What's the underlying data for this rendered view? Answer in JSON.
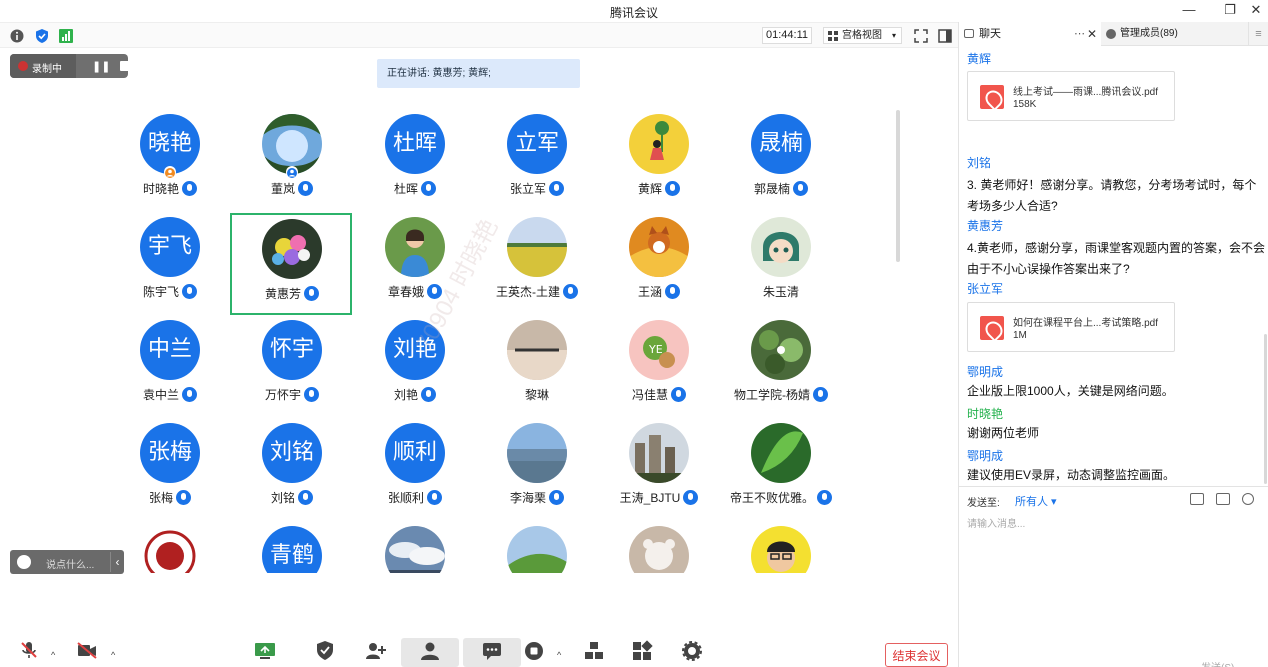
{
  "window": {
    "title": "腾讯会议",
    "min": "—",
    "max": "❐",
    "close": "✕"
  },
  "toolbar": {
    "timer": "01:44:11",
    "view_label": "宫格视图"
  },
  "recording": {
    "label": "录制中"
  },
  "speaking": {
    "text": "正在讲话: 黄惠芳; 黄辉;"
  },
  "grid": [
    {
      "name": "时晓艳",
      "avatar_text": "晓艳",
      "mic": true,
      "host_badge": true
    },
    {
      "name": "董岚",
      "avatar_img": "tree-sky",
      "mic": true,
      "user_badge": true
    },
    {
      "name": "杜晖",
      "avatar_text": "杜晖",
      "mic": true
    },
    {
      "name": "张立军",
      "avatar_text": "立军",
      "mic": true
    },
    {
      "name": "黄辉",
      "avatar_img": "girl-flower",
      "mic": true
    },
    {
      "name": "郭晟楠",
      "avatar_text": "晟楠",
      "mic": true
    },
    {
      "name": "陈宇飞",
      "avatar_text": "宇飞",
      "mic": true
    },
    {
      "name": "黄惠芳",
      "avatar_img": "flowers",
      "mic": true,
      "active": true
    },
    {
      "name": "章春娥",
      "avatar_img": "woman-blue",
      "mic": true
    },
    {
      "name": "王英杰-土建",
      "avatar_img": "field",
      "mic": true
    },
    {
      "name": "王涵",
      "avatar_img": "dog",
      "mic": true
    },
    {
      "name": "朱玉清",
      "avatar_img": "anime",
      "mic": false
    },
    {
      "name": "袁中兰",
      "avatar_text": "中兰",
      "mic": true
    },
    {
      "name": "万怀宇",
      "avatar_text": "怀宇",
      "mic": true
    },
    {
      "name": "刘艳",
      "avatar_text": "刘艳",
      "mic": true
    },
    {
      "name": "黎琳",
      "avatar_img": "sunset",
      "mic": false
    },
    {
      "name": "冯佳慧",
      "avatar_img": "cartoon",
      "mic": true
    },
    {
      "name": "物工学院-杨婧",
      "avatar_img": "leaves",
      "mic": true
    },
    {
      "name": "张梅",
      "avatar_text": "张梅",
      "mic": true
    },
    {
      "name": "刘铭",
      "avatar_text": "刘铭",
      "mic": true
    },
    {
      "name": "张顺利",
      "avatar_text": "顺利",
      "mic": true
    },
    {
      "name": "李海栗",
      "avatar_img": "beach",
      "mic": true
    },
    {
      "name": "王涛_BJTU",
      "avatar_img": "city",
      "mic": true
    },
    {
      "name": "帝王不败优雅。",
      "avatar_img": "green-leaf",
      "mic": true
    },
    {
      "name": "",
      "avatar_img": "seal"
    },
    {
      "name": "",
      "avatar_text": "青鹤"
    },
    {
      "name": "",
      "avatar_img": "clouds"
    },
    {
      "name": "",
      "avatar_img": "hill"
    },
    {
      "name": "",
      "avatar_img": "bear"
    },
    {
      "name": "",
      "avatar_img": "man-glasses"
    }
  ],
  "watermark": "70904 时晓艳",
  "say_something": {
    "placeholder": "说点什么..."
  },
  "bottombar": [
    {
      "label": "解除静音",
      "icon": "mic-off-icon"
    },
    {
      "label": "开启视频",
      "icon": "video-off-icon"
    },
    {
      "label": "共享屏幕",
      "icon": "share-screen-icon"
    },
    {
      "label": "安全",
      "icon": "security-icon"
    },
    {
      "label": "邀请",
      "icon": "invite-icon"
    },
    {
      "label": "管理成员(89)",
      "icon": "members-icon"
    },
    {
      "label": "聊天",
      "icon": "chat-icon"
    },
    {
      "label": "结束录制",
      "icon": "record-stop-icon"
    },
    {
      "label": "分组讨论",
      "icon": "breakout-icon"
    },
    {
      "label": "应用",
      "icon": "apps-icon"
    },
    {
      "label": "设置",
      "icon": "settings-icon"
    }
  ],
  "end_meeting": "结束会议",
  "chat": {
    "tab_label": "聊天",
    "tab_more": "⋯",
    "tab_close": "✕",
    "members_tab": "管理成员(89)",
    "tab_menu": "≡",
    "messages": [
      {
        "sender": "黄辉",
        "file": {
          "name": "线上考试——雨课...腾讯会议.pdf",
          "size": "158K"
        }
      },
      {
        "sender": "刘铭",
        "text": "3. 黄老师好！感谢分享。请教您，分考场考试时，每个考场多少人合适?"
      },
      {
        "sender": "黄惠芳",
        "text": "4.黄老师，感谢分享，雨课堂客观题内置的答案，会不会由于不小心误操作答案出来了?"
      },
      {
        "sender": "张立军",
        "file": {
          "name": "如何在课程平台上...考试策略.pdf",
          "size": "1M"
        }
      },
      {
        "sender": "鄂明成",
        "text": "企业版上限1000人，关键是网络问题。"
      },
      {
        "sender": "时晓艳",
        "text": "谢谢两位老师",
        "green": true
      },
      {
        "sender": "鄂明成",
        "text": "建议使用EV录屏，动态调整监控画面。"
      }
    ],
    "send_to_label": "发送至:",
    "send_to_value": "所有人",
    "input_placeholder": "请输入消息...",
    "send_label": "发送(S)"
  }
}
